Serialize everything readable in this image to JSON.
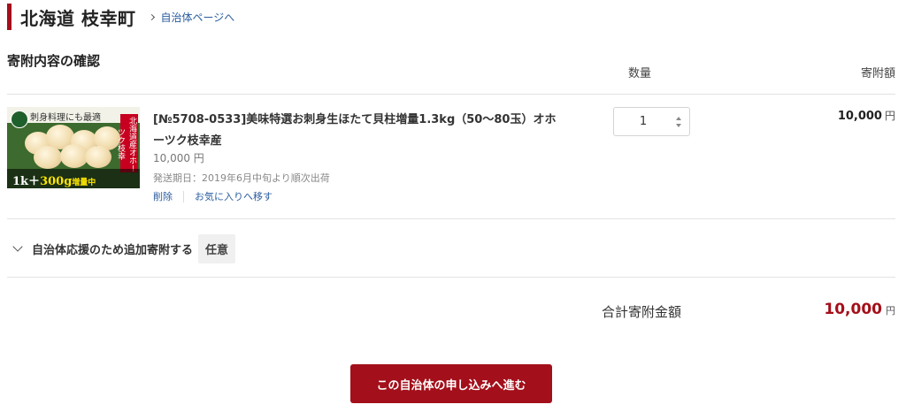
{
  "header": {
    "municipality": "北海道 枝幸町",
    "link_label": "自治体ページへ"
  },
  "cart": {
    "section_title": "寄附内容の確認",
    "col_quantity": "数量",
    "col_amount": "寄附額",
    "items": [
      {
        "thumbnail_text": {
          "top": "刺身料理にも最適",
          "badge": "北海道産オホーツク枝幸",
          "bottom_prefix": "1k＋",
          "bottom_highlight": "300g",
          "bottom_suffix": "増量中"
        },
        "title": "[№5708-0533]美味特選お刺身生ほたて貝柱増量1.3kg（50～80玉）オホーツク枝幸産",
        "price": "10,000 円",
        "shipping": "発送期日：2019年6月中旬より順次出荷",
        "delete_label": "削除",
        "favorite_label": "お気に入りへ移す",
        "quantity": "1",
        "amount": "10,000",
        "amount_unit": "円"
      }
    ]
  },
  "extra_donation": {
    "label": "自治体応援のため追加寄附する",
    "tag": "任意"
  },
  "total": {
    "label": "合計寄附金額",
    "amount": "10,000",
    "unit": "円"
  },
  "proceed_button": "この自治体の申し込みへ進む",
  "colors": {
    "brand": "#a30f1a",
    "link": "#2a5d9f"
  },
  "icons": [
    "chevron-right-icon",
    "chevron-down-icon",
    "select-arrows-icon",
    "municipality-logo-icon"
  ]
}
